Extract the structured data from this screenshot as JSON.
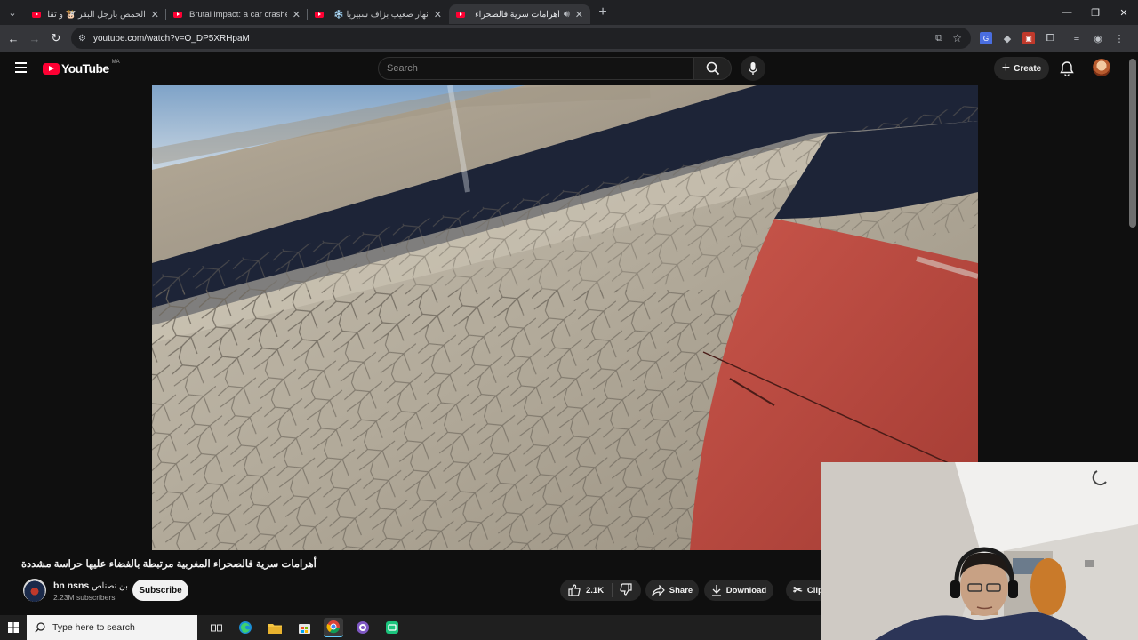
{
  "browser": {
    "tabs": [
      {
        "title": "الحمص بأرجل البقر 🐮 و تقليم أ...",
        "active": false
      },
      {
        "title": "Brutal impact: a car crashes",
        "active": false
      },
      {
        "title": "نهار صعيب بزاف سبيريا ❄️ خاد...",
        "active": false
      },
      {
        "title": "أهرامات سرية فالصحراء المغ...",
        "active": true
      }
    ],
    "url": "youtube.com/watch?v=O_DP5XRHpaM",
    "new_tab_label": "+"
  },
  "youtube": {
    "logo_text": "YouTube",
    "country_code": "MA",
    "search_placeholder": "Search",
    "create_label": "Create"
  },
  "video": {
    "title": "أهرامات سرية فالصحراء المغربية مرتبطة بالفضاء عليها حراسة مشددة",
    "channel_name": "bn nsns",
    "channel_suffix": "بن نصناص",
    "subscribers": "2.23M subscribers",
    "subscribe_label": "Subscribe",
    "likes": "2.1K",
    "share_label": "Share",
    "download_label": "Download",
    "clip_label": "Clip"
  },
  "taskbar": {
    "search_placeholder": "Type here to search"
  },
  "colors": {
    "yt_red": "#ff0033",
    "bg": "#0f0f0f",
    "tab_active": "#35363a"
  }
}
